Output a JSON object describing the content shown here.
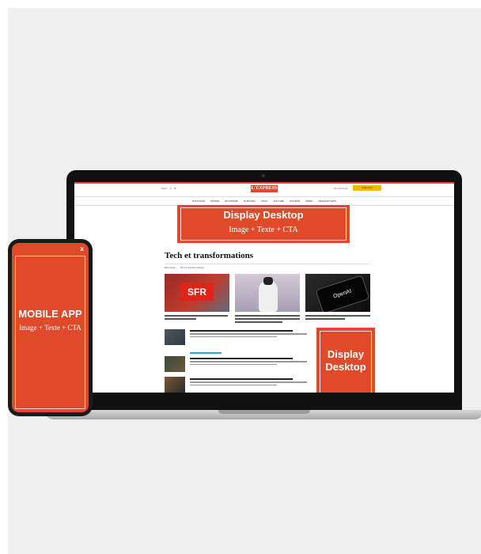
{
  "brand_color": "#e04a2b",
  "site": {
    "logo": "L'EXPRESS",
    "header_links": [
      "Menu",
      "Q",
      "⚙"
    ],
    "signin": "Se connecter",
    "subscribe": "S'abonner",
    "nav": [
      "POLITIQUE",
      "MONDE",
      "ÉCONOMIE",
      "SCIENCES",
      "TECH",
      "CULTURE",
      "SOCIÉTÉ",
      "IDÉES",
      "NEWSLETTERS"
    ],
    "section_title": "Tech et transformations",
    "tabs": [
      "Économie",
      "Tech et transformations"
    ]
  },
  "ad_banner": {
    "title": "Display Desktop",
    "subtitle": "Image + Texte + CTA"
  },
  "ad_side": {
    "line1": "Display",
    "line2": "Desktop"
  },
  "articles": [
    {
      "image": "sfr",
      "logo_text": "SFR"
    },
    {
      "image": "robot"
    },
    {
      "image": "openai",
      "logo_text": "OpenAI"
    }
  ],
  "phone_ad": {
    "close": "x",
    "title": "MOBILE APP",
    "subtitle": "Image + Texte + CTA"
  }
}
